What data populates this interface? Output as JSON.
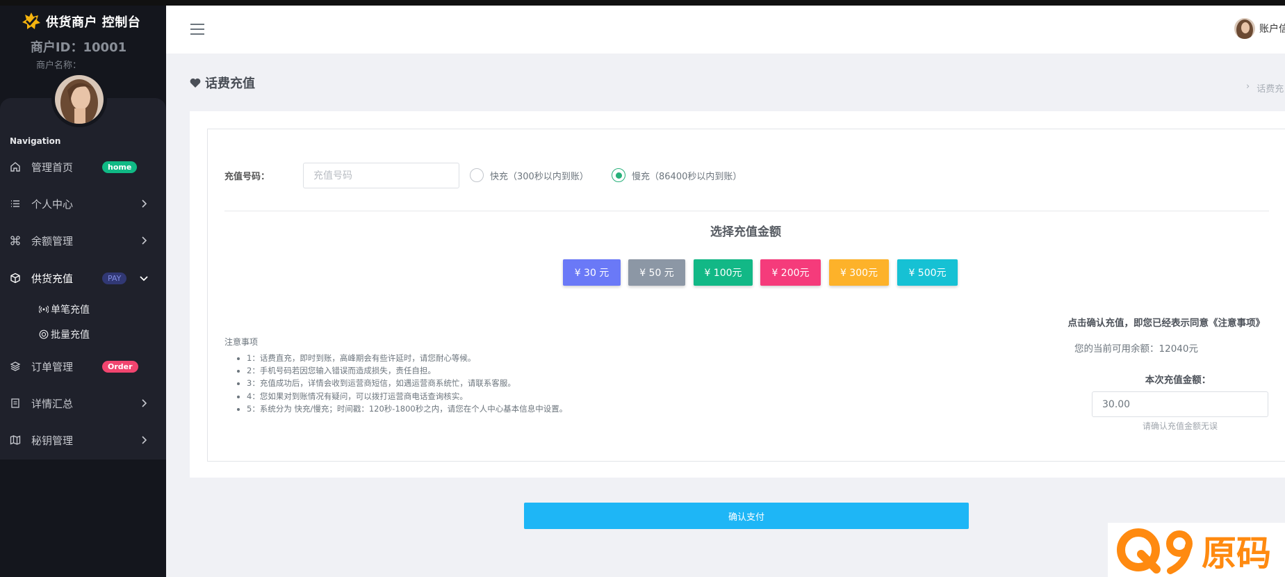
{
  "app": {
    "brand_title": "供货商户 控制台",
    "merchant_id": "商户ID：10001",
    "merchant_name_label": "商户名称："
  },
  "sidebar": {
    "heading": "Navigation",
    "items": [
      {
        "label": "管理首页",
        "icon": "home-icon",
        "badge": "home"
      },
      {
        "label": "个人中心",
        "icon": "list-icon"
      },
      {
        "label": "余额管理",
        "icon": "command-icon"
      },
      {
        "label": "供货充值",
        "icon": "box-icon",
        "badge": "PAY",
        "expanded": true
      },
      {
        "label": "订单管理",
        "icon": "layers-icon",
        "badge": "Order"
      },
      {
        "label": "详情汇总",
        "icon": "document-icon"
      },
      {
        "label": "秘钥管理",
        "icon": "map-icon"
      }
    ],
    "subitems": [
      {
        "label": "单笔充值",
        "icon": "broadcast-icon"
      },
      {
        "label": "批量充值",
        "icon": "globe-icon"
      }
    ]
  },
  "header": {
    "user_name": "账户信"
  },
  "page": {
    "title": "话费充值",
    "breadcrumb": "话费充"
  },
  "form": {
    "phone_label": "充值号码：",
    "phone_placeholder": "充值号码",
    "phone_value": "",
    "options": [
      {
        "label": "快充（300秒以内到账）",
        "checked": false
      },
      {
        "label": "慢充（86400秒以内到账）",
        "checked": true
      }
    ],
    "amount_heading": "选择充值金额",
    "amounts": [
      {
        "label": "¥ 30 元",
        "color": "#6a79f7"
      },
      {
        "label": "¥ 50 元",
        "color": "#8c97a5"
      },
      {
        "label": "¥ 100元",
        "color": "#12b886"
      },
      {
        "label": "¥ 200元",
        "color": "#f53b7b"
      },
      {
        "label": "¥ 300元",
        "color": "#fdb22a"
      },
      {
        "label": "¥ 500元",
        "color": "#16c1d4"
      }
    ],
    "notice_title": "注意事项",
    "notices": [
      "1：话费直充，即时到账，高峰期会有些许延时，请您耐心等候。",
      "2：手机号码若因您输入错误而造成损失，责任自担。",
      "3：充值成功后，详情会收到运营商短信，如遇运营商系统忙，请联系客服。",
      "4：您如果对到账情况有疑问，可以拨打运营商电话查询核实。",
      "5：系统分为 快充/慢充；时间戳：120秒-1800秒之内，请您在个人中心基本信息中设置。"
    ],
    "agree_text": "点击确认充值，即您已经表示同意《注意事项》",
    "balance_text": "您的当前可用余额：12040元",
    "amount_label": "本次充值金额：",
    "amount_value": "30.00",
    "amount_hint": "请确认充值金额无误",
    "pay_label": "确认支付"
  },
  "watermark": {
    "text": "Q9原码"
  },
  "colors": {
    "sidebar_bg": "#14161d",
    "pay_button": "#1eb6f6",
    "badge_home": "#10b985",
    "badge_order": "#f1456f"
  }
}
